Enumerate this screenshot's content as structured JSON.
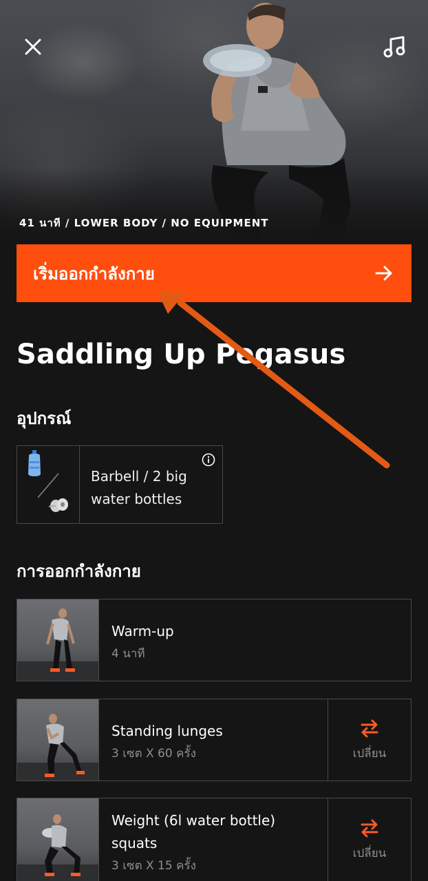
{
  "header": {
    "meta": "41 นาที / LOWER BODY / NO EQUIPMENT",
    "close_icon": "close-icon",
    "music_icon": "music-note-icon"
  },
  "start_button": {
    "label": "เริ่มออกกำลังกาย",
    "icon": "arrow-right-icon"
  },
  "workout": {
    "title": "Saddling Up Pegasus"
  },
  "equipment": {
    "heading": "อุปกรณ์",
    "line1": "Barbell / 2 big",
    "line2": "water bottles",
    "info_icon": "info-icon"
  },
  "exercises": {
    "heading": "การออกกำลังกาย",
    "items": [
      {
        "name": "Warm-up",
        "detail": "4 นาที"
      },
      {
        "name": "Standing lunges",
        "detail": "3 เซต X 60 ครั้ง",
        "swap_label": "เปลี่ยน"
      },
      {
        "name": "Weight (6l water bottle)",
        "name2": "squats",
        "detail": "3 เซต X 15 ครั้ง",
        "swap_label": "เปลี่ยน"
      }
    ]
  },
  "colors": {
    "accent": "#ff4e0e",
    "background": "#151515",
    "border": "#4a4a4a",
    "muted_text": "#8f8f8f"
  }
}
